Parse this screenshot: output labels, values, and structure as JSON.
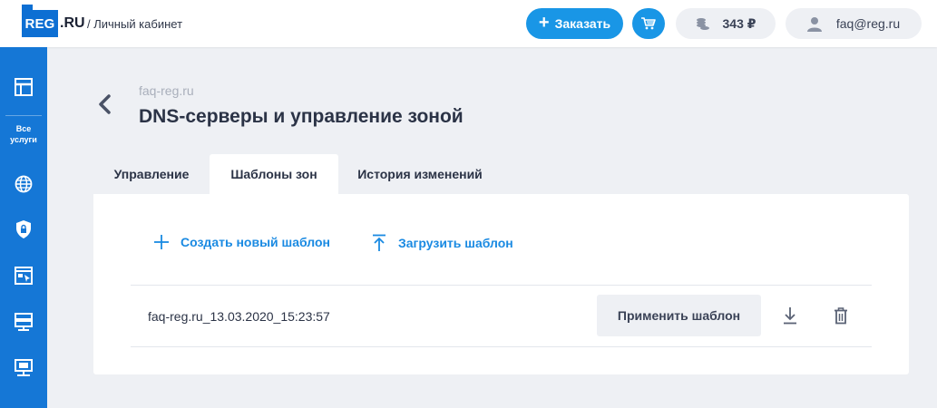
{
  "header": {
    "logo_main": "REG",
    "logo_suffix": ".RU",
    "breadcrumb": "/ Личный кабинет",
    "order_label": "Заказать",
    "balance": "343 ₽",
    "user_email": "faq@reg.ru"
  },
  "sidebar": {
    "all_services_line1": "Все",
    "all_services_line2": "услуги",
    "items": [
      "dashboard-icon",
      "globe-icon",
      "shield-lock-icon",
      "website-builder-icon",
      "server-icon",
      "vps-icon"
    ]
  },
  "page": {
    "domain": "faq-reg.ru",
    "title": "DNS-серверы и управление зоной"
  },
  "tabs": [
    {
      "label": "Управление",
      "active": false
    },
    {
      "label": "Шаблоны зон",
      "active": true
    },
    {
      "label": "История изменений",
      "active": false
    }
  ],
  "actions": {
    "create": "Создать новый шаблон",
    "upload": "Загрузить шаблон"
  },
  "templates": [
    {
      "name": "faq-reg.ru_13.03.2020_15:23:57",
      "apply_label": "Применить шаблон"
    }
  ],
  "colors": {
    "accent": "#1996e6",
    "sidebar": "#1577d6",
    "background": "#eef0f4"
  }
}
